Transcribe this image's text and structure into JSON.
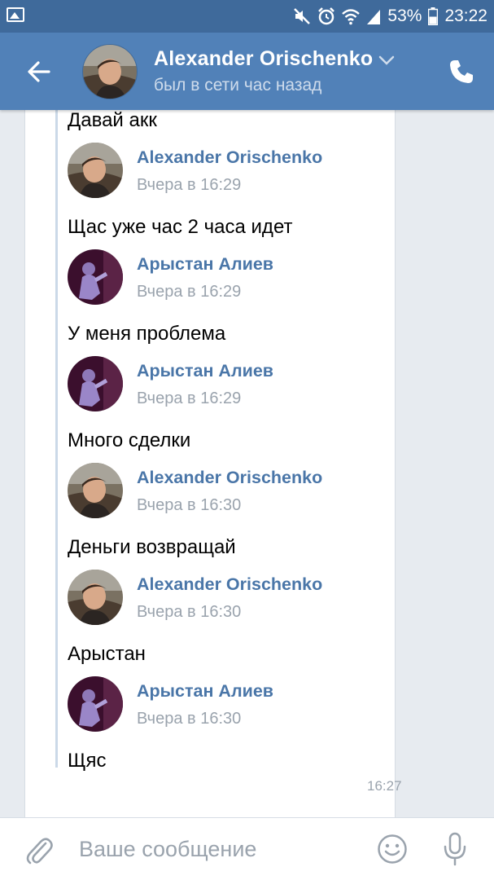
{
  "status_bar": {
    "battery": "53%",
    "time": "23:22"
  },
  "header": {
    "contact_name": "Alexander Orischenko",
    "last_seen": "был в сети час назад"
  },
  "messages": [
    {
      "kind": "text",
      "text": "Давай акк"
    },
    {
      "kind": "sender",
      "name": "Alexander Orischenko",
      "time": "Вчера в 16:29",
      "avatar": "alexander"
    },
    {
      "kind": "text",
      "text": "Щас уже час 2 часа идет"
    },
    {
      "kind": "sender",
      "name": "Арыстан Алиев",
      "time": "Вчера в 16:29",
      "avatar": "arystan"
    },
    {
      "kind": "text",
      "text": "У меня проблема"
    },
    {
      "kind": "sender",
      "name": "Арыстан Алиев",
      "time": "Вчера в 16:29",
      "avatar": "arystan"
    },
    {
      "kind": "text",
      "text": "Много сделки"
    },
    {
      "kind": "sender",
      "name": "Alexander Orischenko",
      "time": "Вчера в 16:30",
      "avatar": "alexander"
    },
    {
      "kind": "text",
      "text": "Деньги возвращай"
    },
    {
      "kind": "sender",
      "name": "Alexander Orischenko",
      "time": "Вчера в 16:30",
      "avatar": "alexander"
    },
    {
      "kind": "text",
      "text": "Арыстан"
    },
    {
      "kind": "sender",
      "name": "Арыстан Алиев",
      "time": "Вчера в 16:30",
      "avatar": "arystan"
    },
    {
      "kind": "text",
      "text": "Щяс"
    }
  ],
  "bubble_time": "16:27",
  "composer": {
    "placeholder": "Ваше сообщение"
  },
  "colors": {
    "header": "#5181b8",
    "status_bar": "#3f6a9b",
    "sender_name": "#4a76a8",
    "background": "#e7ebf0"
  },
  "icons": [
    "gallery-icon",
    "mute-icon",
    "alarm-icon",
    "wifi-icon",
    "signal-icon",
    "battery-icon",
    "back-arrow-icon",
    "chevron-down-icon",
    "phone-icon",
    "paperclip-icon",
    "smiley-icon",
    "microphone-icon"
  ]
}
